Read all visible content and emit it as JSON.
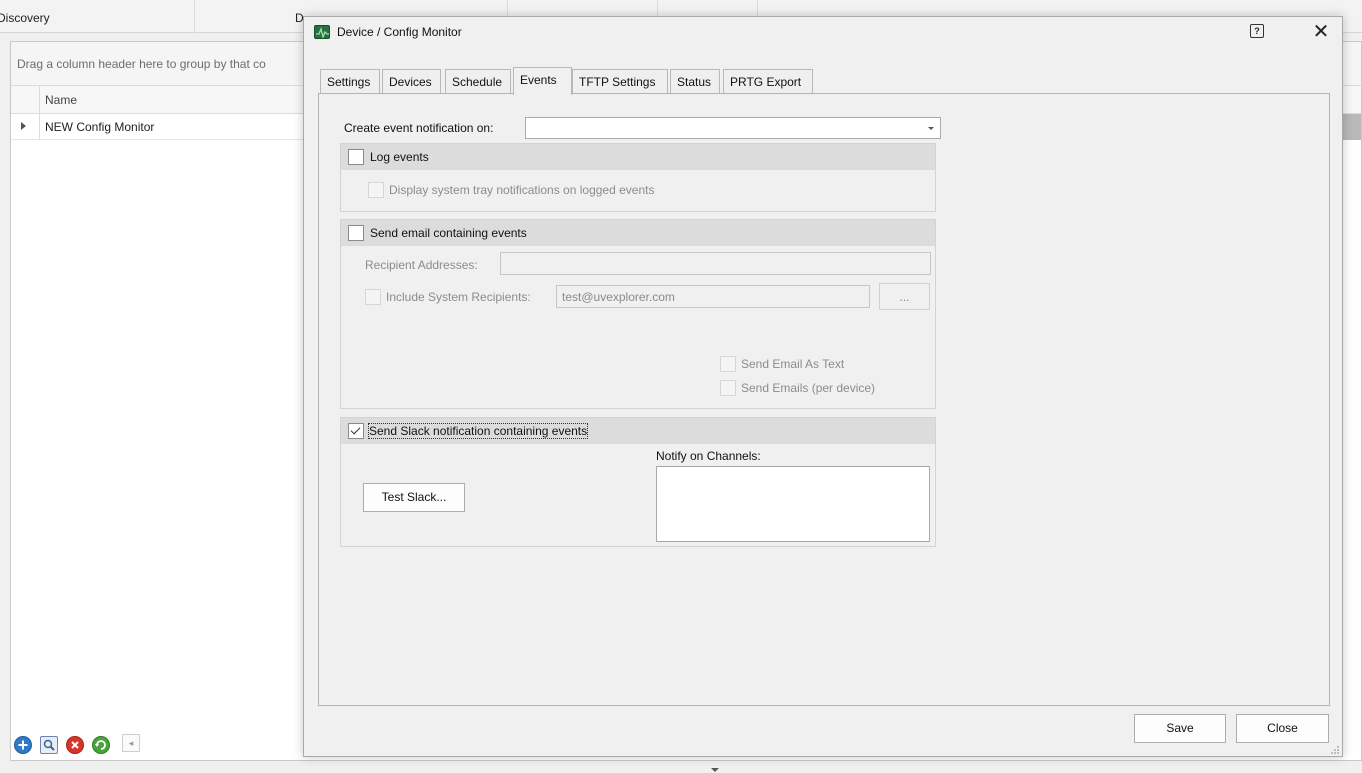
{
  "background": {
    "tabs": [
      {
        "label": "Discovery"
      },
      {
        "label": "D"
      }
    ],
    "grid": {
      "group_hint": "Drag a column header here to group by that co",
      "column_name": "Name",
      "rows": [
        {
          "name": "NEW Config Monitor"
        }
      ]
    },
    "toolbar": {
      "icons": [
        "add-icon",
        "search-icon",
        "delete-icon",
        "refresh-icon"
      ],
      "scroll_left_glyph": "◂"
    }
  },
  "dialog": {
    "title": "Device / Config Monitor",
    "help_glyph": "?",
    "close_glyph": "✕",
    "tabs": [
      {
        "label": "Settings",
        "active": false
      },
      {
        "label": "Devices",
        "active": false
      },
      {
        "label": "Schedule",
        "active": false
      },
      {
        "label": "Events",
        "active": true
      },
      {
        "label": "TFTP Settings",
        "active": false
      },
      {
        "label": "Status",
        "active": false
      },
      {
        "label": "PRTG Export",
        "active": false
      }
    ],
    "events": {
      "create_on_label": "Create event notification on:",
      "create_on_value": "",
      "log_events": {
        "label": "Log events",
        "checked": false,
        "tray_label": "Display system tray notifications on logged events",
        "tray_checked": false
      },
      "email": {
        "label": "Send email containing events",
        "checked": false,
        "recipients_label": "Recipient Addresses:",
        "recipients_value": "",
        "include_system_label": "Include System Recipients:",
        "include_system_checked": false,
        "system_recipients_value": "test@uvexplorer.com",
        "browse_label": "...",
        "as_text_label": "Send Email As Text",
        "as_text_checked": false,
        "per_device_label": "Send Emails (per device)",
        "per_device_checked": false
      },
      "slack": {
        "label": "Send Slack notification containing events",
        "checked": true,
        "test_button": "Test Slack...",
        "channels_label": "Notify on Channels:",
        "channels": []
      }
    },
    "footer": {
      "save": "Save",
      "close": "Close"
    }
  }
}
